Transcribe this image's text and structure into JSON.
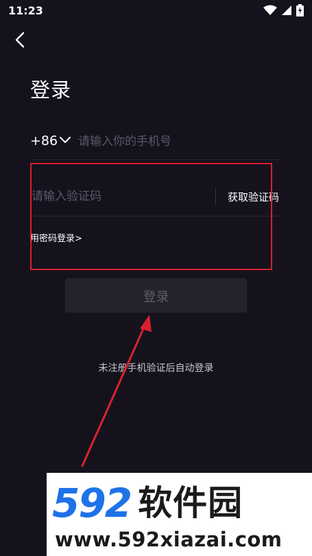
{
  "status_bar": {
    "time": "11:23",
    "icons": [
      "wifi-icon",
      "signal-icon",
      "battery-charging-icon"
    ]
  },
  "header": {
    "back_icon": "chevron-left-icon",
    "title": "登录"
  },
  "phone": {
    "country_code": "+86",
    "placeholder": "请输入你的手机号"
  },
  "verification": {
    "placeholder": "请输入验证码",
    "get_code_label": "获取验证码"
  },
  "password_login_link": "用密码登录>",
  "login_button_label": "登录",
  "auto_register_note": "未注册手机验证后自动登录",
  "watermark": {
    "number": "592",
    "name": "软件园",
    "url": "www.592xiazai.com"
  },
  "colors": {
    "background": "#15121e",
    "annotation_red": "#d8222e",
    "watermark_blue": "#1e73e8",
    "button_bg": "#25222d",
    "placeholder": "#5c5966"
  }
}
